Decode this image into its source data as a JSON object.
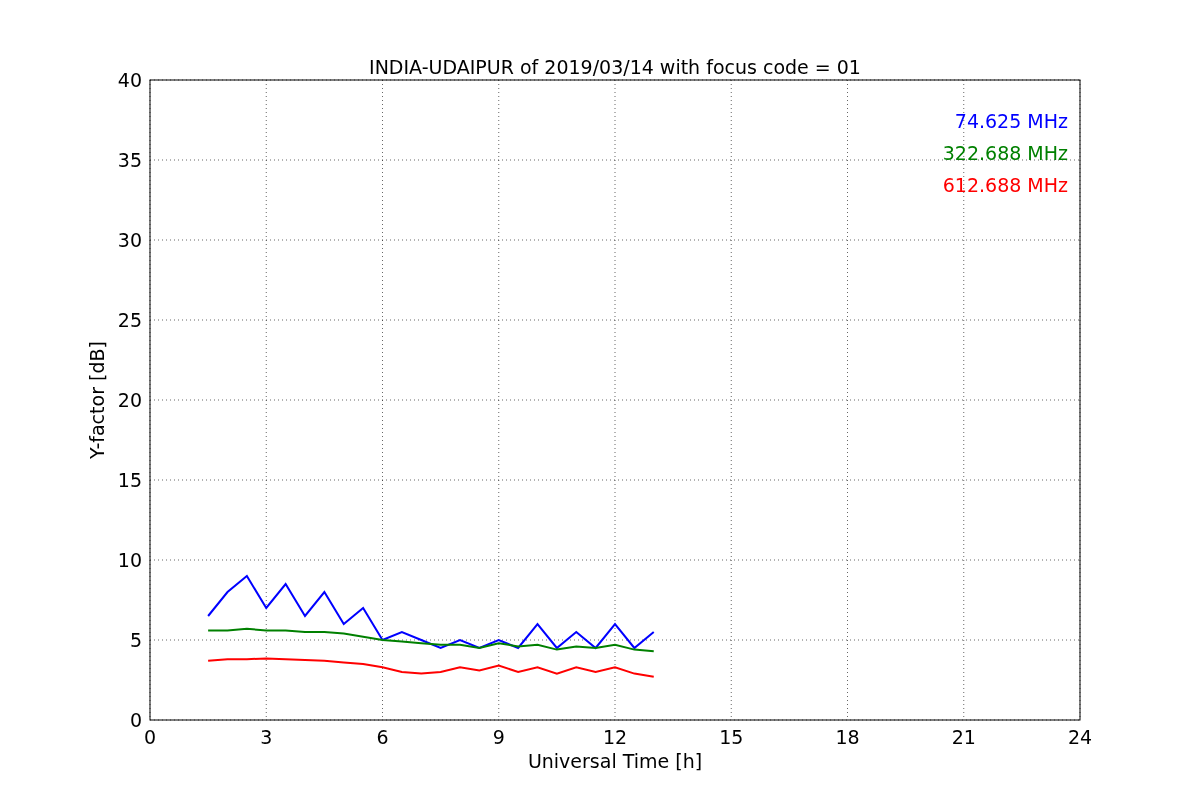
{
  "figure": {
    "chart_data": {
      "type": "line",
      "title": "INDIA-UDAIPUR of 2019/03/14 with focus code = 01",
      "xlabel": "Universal Time [h]",
      "ylabel": "Y-factor [dB]",
      "x": [
        1.5,
        2,
        2.5,
        3,
        3.5,
        4,
        4.5,
        5,
        5.5,
        6,
        6.5,
        7,
        7.5,
        8,
        8.5,
        9,
        9.5,
        10,
        10.5,
        11,
        11.5,
        12,
        12.5,
        13
      ],
      "series": [
        {
          "name": "74.625 MHz",
          "color": "#0000ff",
          "values": [
            6.5,
            8,
            9,
            7,
            8.5,
            6.5,
            8,
            6,
            7,
            5,
            5.5,
            5,
            4.5,
            5,
            4.5,
            5,
            4.5,
            6,
            4.5,
            5.5,
            4.5,
            6,
            4.5,
            5.5
          ]
        },
        {
          "name": "322.688 MHz",
          "color": "#008000",
          "values": [
            5.6,
            5.6,
            5.7,
            5.6,
            5.6,
            5.5,
            5.5,
            5.4,
            5.2,
            5,
            4.9,
            4.8,
            4.7,
            4.7,
            4.5,
            4.8,
            4.6,
            4.7,
            4.4,
            4.6,
            4.5,
            4.7,
            4.4,
            4.3
          ]
        },
        {
          "name": "612.688 MHz",
          "color": "#ff0000",
          "values": [
            3.7,
            3.8,
            3.8,
            3.85,
            3.8,
            3.75,
            3.7,
            3.6,
            3.5,
            3.3,
            3,
            2.9,
            3,
            3.3,
            3.1,
            3.4,
            3,
            3.3,
            2.9,
            3.3,
            3,
            3.3,
            2.9,
            2.7
          ]
        }
      ],
      "xlim": [
        0,
        24
      ],
      "ylim": [
        0,
        40
      ],
      "xticks": [
        0,
        3,
        6,
        9,
        12,
        15,
        18,
        21,
        24
      ],
      "yticks": [
        0,
        5,
        10,
        15,
        20,
        25,
        30,
        35,
        40
      ],
      "grid": true
    }
  }
}
